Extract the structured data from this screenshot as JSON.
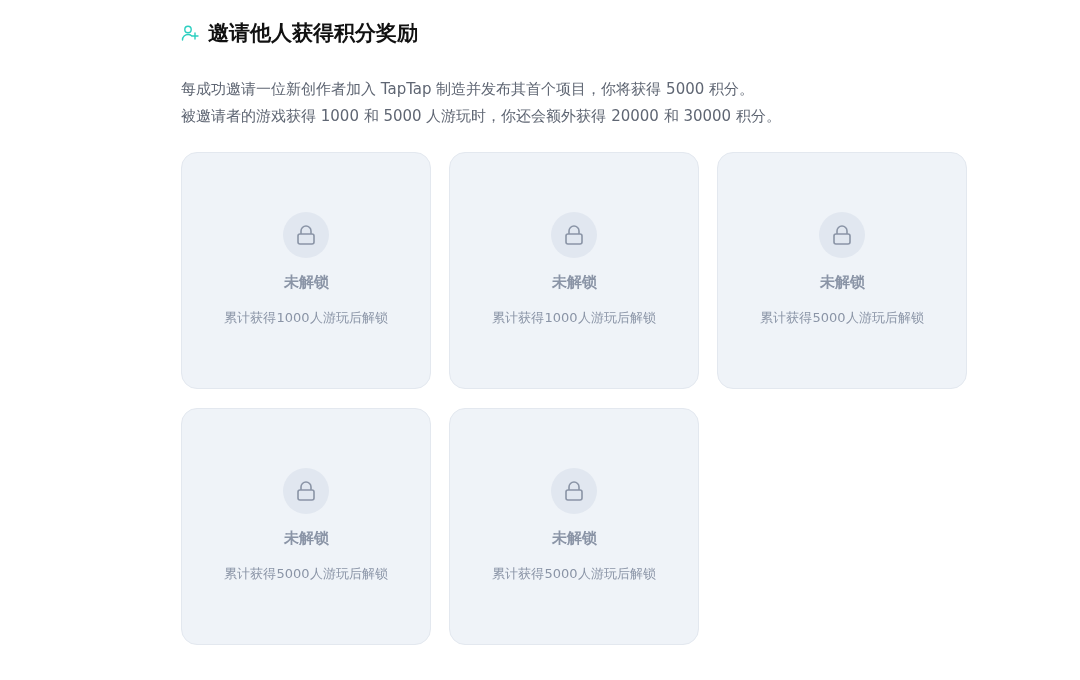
{
  "section": {
    "title": "邀请他人获得积分奖励",
    "description": [
      "每成功邀请一位新创作者加入 TapTap 制造并发布其首个项目，你将获得 5000 积分。",
      "被邀请者的游戏获得 1000 和 5000 人游玩时，你还会额外获得 20000 和 30000 积分。"
    ]
  },
  "rewards": [
    {
      "status": "未解锁",
      "condition": "累计获得1000人游玩后解锁",
      "locked": true
    },
    {
      "status": "未解锁",
      "condition": "累计获得1000人游玩后解锁",
      "locked": true
    },
    {
      "status": "未解锁",
      "condition": "累计获得5000人游玩后解锁",
      "locked": true
    },
    {
      "status": "未解锁",
      "condition": "累计获得5000人游玩后解锁",
      "locked": true
    },
    {
      "status": "未解锁",
      "condition": "累计获得5000人游玩后解锁",
      "locked": true
    }
  ]
}
